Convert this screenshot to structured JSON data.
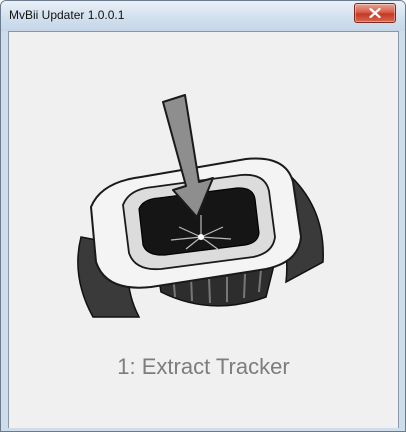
{
  "window": {
    "title": "MvBii Updater 1.0.0.1"
  },
  "controls": {
    "close_icon": "close-x-icon"
  },
  "illustration": {
    "icon": "tracker-extract-illustration"
  },
  "step": {
    "label": "1: Extract Tracker"
  }
}
